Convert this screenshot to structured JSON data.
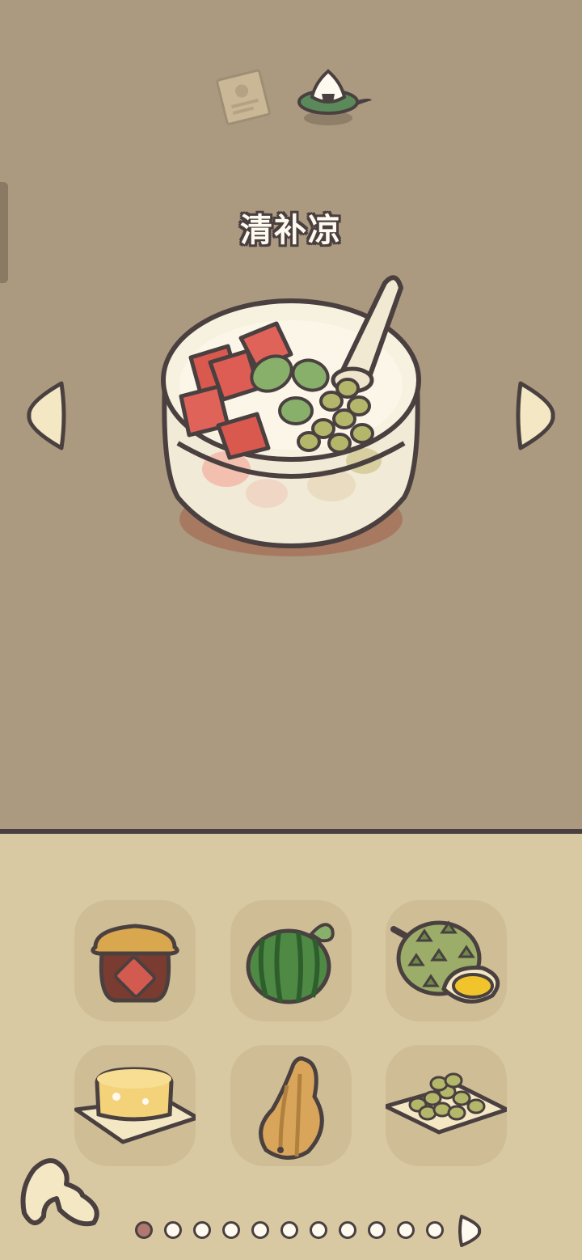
{
  "dish": {
    "title": "清补凉",
    "item": "bowl-of-qingbuliang"
  },
  "top_icons": [
    "recipe-card-icon",
    "onigiri-plate-icon"
  ],
  "navigation": {
    "prev": "arrow-left-icon",
    "next": "arrow-right-icon"
  },
  "ingredients": [
    {
      "name": "honey-jar"
    },
    {
      "name": "watermelon"
    },
    {
      "name": "durian"
    },
    {
      "name": "cheese-pudding"
    },
    {
      "name": "papaya"
    },
    {
      "name": "green-beans"
    }
  ],
  "pager": {
    "total": 11,
    "active_index": 0
  },
  "colors": {
    "background": "#ab9a80",
    "shelf": "#d9c9a2",
    "slot": "#cfbd96",
    "outline": "#4a4040",
    "cream": "#f3e7c4",
    "active_dot": "#b0786e"
  }
}
